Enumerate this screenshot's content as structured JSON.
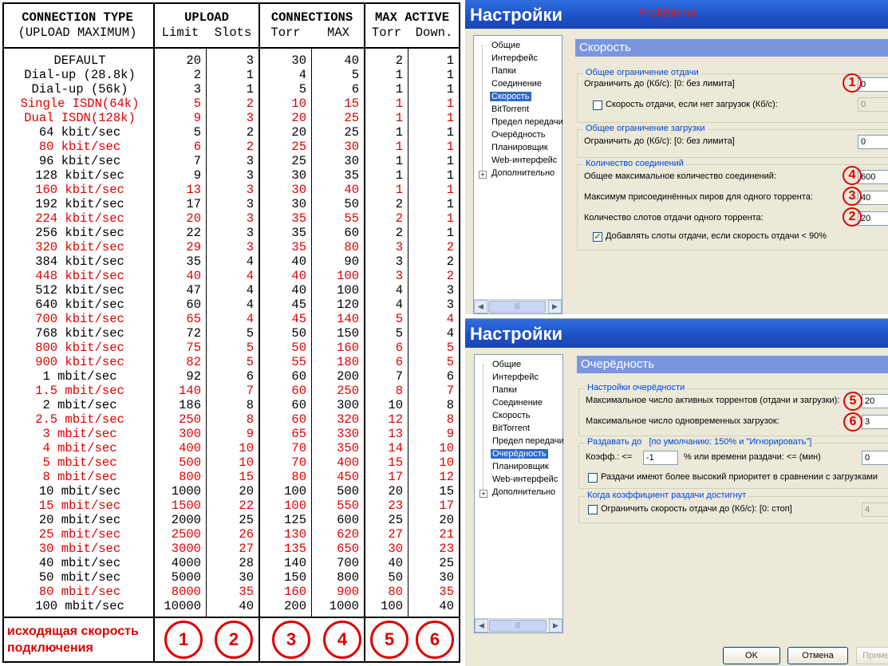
{
  "table": {
    "headers": {
      "conn_type": "CONNECTION TYPE",
      "conn_type_sub": "(UPLOAD MAXIMUM)",
      "upload": "UPLOAD",
      "limit": "Limit",
      "slots": "Slots",
      "connections": "CONNECTIONS",
      "torr": "Torr",
      "max": "MAX",
      "max_active": "MAX ACTIVE",
      "torr2": "Torr",
      "down": "Down."
    },
    "rows": [
      {
        "name": "DEFAULT",
        "limit": "20",
        "slots": "3",
        "torr": "30",
        "max": "40",
        "act_torr": "2",
        "down": "1",
        "red": false
      },
      {
        "name": "Dial-up (28.8k)",
        "limit": "2",
        "slots": "1",
        "torr": "4",
        "max": "5",
        "act_torr": "1",
        "down": "1",
        "red": false
      },
      {
        "name": "Dial-up (56k)",
        "limit": "3",
        "slots": "1",
        "torr": "5",
        "max": "6",
        "act_torr": "1",
        "down": "1",
        "red": false
      },
      {
        "name": "Single ISDN(64k)",
        "limit": "5",
        "slots": "2",
        "torr": "10",
        "max": "15",
        "act_torr": "1",
        "down": "1",
        "red": true
      },
      {
        "name": "Dual ISDN(128k)",
        "limit": "9",
        "slots": "3",
        "torr": "20",
        "max": "25",
        "act_torr": "1",
        "down": "1",
        "red": true
      },
      {
        "name": "64 kbit/sec",
        "limit": "5",
        "slots": "2",
        "torr": "20",
        "max": "25",
        "act_torr": "1",
        "down": "1",
        "red": false
      },
      {
        "name": "80 kbit/sec",
        "limit": "6",
        "slots": "2",
        "torr": "25",
        "max": "30",
        "act_torr": "1",
        "down": "1",
        "red": true
      },
      {
        "name": "96 kbit/sec",
        "limit": "7",
        "slots": "3",
        "torr": "25",
        "max": "30",
        "act_torr": "1",
        "down": "1",
        "red": false
      },
      {
        "name": "128 kbit/sec",
        "limit": "9",
        "slots": "3",
        "torr": "30",
        "max": "35",
        "act_torr": "1",
        "down": "1",
        "red": false
      },
      {
        "name": "160 kbit/sec",
        "limit": "13",
        "slots": "3",
        "torr": "30",
        "max": "40",
        "act_torr": "1",
        "down": "1",
        "red": true
      },
      {
        "name": "192 kbit/sec",
        "limit": "17",
        "slots": "3",
        "torr": "30",
        "max": "50",
        "act_torr": "2",
        "down": "1",
        "red": false
      },
      {
        "name": "224 kbit/sec",
        "limit": "20",
        "slots": "3",
        "torr": "35",
        "max": "55",
        "act_torr": "2",
        "down": "1",
        "red": true
      },
      {
        "name": "256 kbit/sec",
        "limit": "22",
        "slots": "3",
        "torr": "35",
        "max": "60",
        "act_torr": "2",
        "down": "1",
        "red": false
      },
      {
        "name": "320 kbit/sec",
        "limit": "29",
        "slots": "3",
        "torr": "35",
        "max": "80",
        "act_torr": "3",
        "down": "2",
        "red": true
      },
      {
        "name": "384 kbit/sec",
        "limit": "35",
        "slots": "4",
        "torr": "40",
        "max": "90",
        "act_torr": "3",
        "down": "2",
        "red": false
      },
      {
        "name": "448 kbit/sec",
        "limit": "40",
        "slots": "4",
        "torr": "40",
        "max": "100",
        "act_torr": "3",
        "down": "2",
        "red": true
      },
      {
        "name": "512 kbit/sec",
        "limit": "47",
        "slots": "4",
        "torr": "40",
        "max": "100",
        "act_torr": "4",
        "down": "3",
        "red": false
      },
      {
        "name": "640 kbit/sec",
        "limit": "60",
        "slots": "4",
        "torr": "45",
        "max": "120",
        "act_torr": "4",
        "down": "3",
        "red": false
      },
      {
        "name": "700 kbit/sec",
        "limit": "65",
        "slots": "4",
        "torr": "45",
        "max": "140",
        "act_torr": "5",
        "down": "4",
        "red": true
      },
      {
        "name": "768 kbit/sec",
        "limit": "72",
        "slots": "5",
        "torr": "50",
        "max": "150",
        "act_torr": "5",
        "down": "4",
        "red": false
      },
      {
        "name": "800 kbit/sec",
        "limit": "75",
        "slots": "5",
        "torr": "50",
        "max": "160",
        "act_torr": "6",
        "down": "5",
        "red": true
      },
      {
        "name": "900 kbit/sec",
        "limit": "82",
        "slots": "5",
        "torr": "55",
        "max": "180",
        "act_torr": "6",
        "down": "5",
        "red": true
      },
      {
        "name": "1 mbit/sec",
        "limit": "92",
        "slots": "6",
        "torr": "60",
        "max": "200",
        "act_torr": "7",
        "down": "6",
        "red": false
      },
      {
        "name": "1.5 mbit/sec",
        "limit": "140",
        "slots": "7",
        "torr": "60",
        "max": "250",
        "act_torr": "8",
        "down": "7",
        "red": true
      },
      {
        "name": "2 mbit/sec",
        "limit": "186",
        "slots": "8",
        "torr": "60",
        "max": "300",
        "act_torr": "10",
        "down": "8",
        "red": false
      },
      {
        "name": "2.5 mbit/sec",
        "limit": "250",
        "slots": "8",
        "torr": "60",
        "max": "320",
        "act_torr": "12",
        "down": "8",
        "red": true
      },
      {
        "name": "3 mbit/sec",
        "limit": "300",
        "slots": "9",
        "torr": "65",
        "max": "330",
        "act_torr": "13",
        "down": "9",
        "red": true
      },
      {
        "name": "4 mbit/sec",
        "limit": "400",
        "slots": "10",
        "torr": "70",
        "max": "350",
        "act_torr": "14",
        "down": "10",
        "red": true
      },
      {
        "name": "5 mbit/sec",
        "limit": "500",
        "slots": "10",
        "torr": "70",
        "max": "400",
        "act_torr": "15",
        "down": "10",
        "red": true
      },
      {
        "name": "8 mbit/sec",
        "limit": "800",
        "slots": "15",
        "torr": "80",
        "max": "450",
        "act_torr": "17",
        "down": "12",
        "red": true
      },
      {
        "name": "10 mbit/sec",
        "limit": "1000",
        "slots": "20",
        "torr": "100",
        "max": "500",
        "act_torr": "20",
        "down": "15",
        "red": false
      },
      {
        "name": "15 mbit/sec",
        "limit": "1500",
        "slots": "22",
        "torr": "100",
        "max": "550",
        "act_torr": "23",
        "down": "17",
        "red": true
      },
      {
        "name": "20 mbit/sec",
        "limit": "2000",
        "slots": "25",
        "torr": "125",
        "max": "600",
        "act_torr": "25",
        "down": "20",
        "red": false
      },
      {
        "name": "25 mbit/sec",
        "limit": "2500",
        "slots": "26",
        "torr": "130",
        "max": "620",
        "act_torr": "27",
        "down": "21",
        "red": true
      },
      {
        "name": "30 mbit/sec",
        "limit": "3000",
        "slots": "27",
        "torr": "135",
        "max": "650",
        "act_torr": "30",
        "down": "23",
        "red": true
      },
      {
        "name": "40 mbit/sec",
        "limit": "4000",
        "slots": "28",
        "torr": "140",
        "max": "700",
        "act_torr": "40",
        "down": "25",
        "red": false
      },
      {
        "name": "50 mbit/sec",
        "limit": "5000",
        "slots": "30",
        "torr": "150",
        "max": "800",
        "act_torr": "50",
        "down": "30",
        "red": false
      },
      {
        "name": "80 mbit/sec",
        "limit": "8000",
        "slots": "35",
        "torr": "160",
        "max": "900",
        "act_torr": "80",
        "down": "35",
        "red": true
      },
      {
        "name": "100 mbit/sec",
        "limit": "10000",
        "slots": "40",
        "torr": "200",
        "max": "1000",
        "act_torr": "100",
        "down": "40",
        "red": false
      }
    ],
    "footer": {
      "label": "исходящая скорость подключения",
      "markers": [
        "1",
        "2",
        "3",
        "4",
        "5",
        "6"
      ]
    }
  },
  "colors": {
    "red": "#d00000",
    "title_blue": "#1d4fc4",
    "panel_head": "#7a96df",
    "group_title": "#0046d5"
  },
  "dialog1": {
    "title": "Настройки",
    "brand": "ProfiBit/net",
    "tree": [
      "Общие",
      "Интерфейс",
      "Папки",
      "Соединение",
      "Скорость",
      "BitTorrent",
      "Предел передачи",
      "Очерёдность",
      "Планировщик",
      "Web-интерфейс",
      "Дополнительно"
    ],
    "selected_index": 4,
    "panel_title": "Скорость",
    "upload_group": "Общее ограничение отдачи",
    "upload_limit_label": "Ограничить до (Кб/с): [0: без лимита]",
    "upload_limit_value": "0",
    "upload_idle_label": "Скорость отдачи, если нет загрузок (Кб/с):",
    "upload_idle_value": "0",
    "download_group": "Общее ограничение загрузки",
    "download_limit_label": "Ограничить до (Кб/с): [0: без лимита]",
    "download_limit_value": "0",
    "conn_group": "Количество соединений",
    "max_conn_label": "Общее максимальное количество соединений:",
    "max_conn_value": "600",
    "max_peers_label": "Максимум присоединённых пиров для одного торрента:",
    "max_peers_value": "40",
    "slots_label": "Количество слотов отдачи одного торрента:",
    "slots_value": "20",
    "extra_slots_label": "Добавлять слоты отдачи, если скорость отдачи < 90%",
    "markers": {
      "upload": "1",
      "max_conn": "4",
      "max_peers": "3",
      "slots": "2"
    }
  },
  "dialog2": {
    "title": "Настройки",
    "tree": [
      "Общие",
      "Интерфейс",
      "Папки",
      "Соединение",
      "Скорость",
      "BitTorrent",
      "Предел передачи",
      "Очерёдность",
      "Планировщик",
      "Web-интерфейс",
      "Дополнительно"
    ],
    "selected_index": 7,
    "panel_title": "Очерёдность",
    "queue_group": "Настройки очерёдности",
    "active_label": "Максимальное число активных торрентов (отдачи и загрузки):",
    "active_value": "20",
    "downloads_label": "Максимальное число одновременных загрузок:",
    "downloads_value": "3",
    "seed_group": "Раздавать до",
    "seed_group_hint": "[по умолчанию: 150% и \"Игнорировать\"]",
    "ratio_label": "Коэфф.: <=",
    "ratio_value": "-1",
    "time_label": "% или времени раздачи: <= (мин)",
    "time_value": "0",
    "priority_label": "Раздачи имеют более высокий приоритет в сравнении с загрузками",
    "ratio_reached_group": "Когда коэффициент раздачи достигнут",
    "limit_label": "Ограничить скорость отдачи до (Кб/с): [0: стоп]",
    "limit_value": "4",
    "markers": {
      "active": "5",
      "downloads": "6"
    }
  },
  "buttons": {
    "ok": "OK",
    "cancel": "Отмена",
    "apply": "Приме"
  }
}
